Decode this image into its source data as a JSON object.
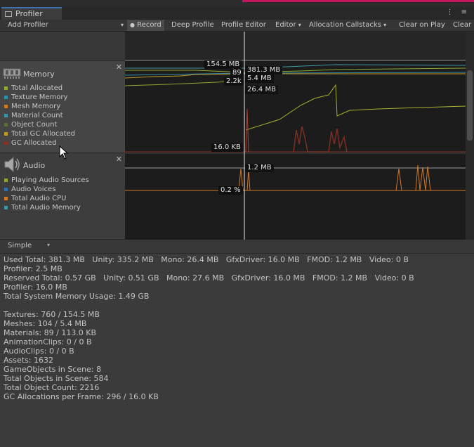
{
  "window": {
    "tab_title": "Profiler",
    "tab_icon": "profiler-icon",
    "window_buttons": "⋮ ≡"
  },
  "toolbar": {
    "add_profiler": "Add Profiler",
    "record": "Record",
    "deep_profile": "Deep Profile",
    "profile_editor": "Profile Editor",
    "editor": "Editor",
    "allocation_callstacks": "Allocation Callstacks",
    "clear_on_play": "Clear on Play",
    "clear": "Clear"
  },
  "memory": {
    "title": "Memory",
    "icon": "memory-chip-icon",
    "legend": [
      {
        "label": "Total Allocated",
        "color": "#8fa832"
      },
      {
        "label": "Texture Memory",
        "color": "#2f8fae"
      },
      {
        "label": "Mesh Memory",
        "color": "#d07a26"
      },
      {
        "label": "Material Count",
        "color": "#3f96a6"
      },
      {
        "label": "Object Count",
        "color": "#5a6e35"
      },
      {
        "label": "Total GC Allocated",
        "color": "#c29a2a"
      },
      {
        "label": "GC Allocated",
        "color": "#8a2f22"
      }
    ],
    "graph_labels": {
      "texture": "154.5 MB",
      "material": "89",
      "objects": "2.2k",
      "gc": "16.0 KB",
      "total": "381.3 MB",
      "mesh": "5.4 MB",
      "mono": "26.4 MB"
    }
  },
  "audio": {
    "title": "Audio",
    "icon": "speaker-icon",
    "legend": [
      {
        "label": "Playing Audio Sources",
        "color": "#8fa832"
      },
      {
        "label": "Audio Voices",
        "color": "#2f6fae"
      },
      {
        "label": "Total Audio CPU",
        "color": "#d07a26"
      },
      {
        "label": "Total Audio Memory",
        "color": "#3f96a6"
      }
    ],
    "graph_labels": {
      "memory": "1.2 MB",
      "cpu": "0.2 %"
    }
  },
  "detail_view": {
    "mode": "Simple",
    "lines": [
      "Used Total: 381.3 MB   Unity: 335.2 MB   Mono: 26.4 MB   GfxDriver: 16.0 MB   FMOD: 1.2 MB   Video: 0 B",
      "Profiler: 2.5 MB",
      "Reserved Total: 0.57 GB   Unity: 0.51 GB   Mono: 27.6 MB   GfxDriver: 16.0 MB   FMOD: 1.2 MB   Video: 0 B",
      "Profiler: 16.0 MB",
      "Total System Memory Usage: 1.49 GB",
      "",
      "Textures: 760 / 154.5 MB",
      "Meshes: 104 / 5.4 MB",
      "Materials: 89 / 113.0 KB",
      "AnimationClips: 0 / 0 B",
      "AudioClips: 0 / 0 B",
      "Assets: 1632",
      "GameObjects in Scene: 8",
      "Total Objects in Scene: 584",
      "Total Object Count: 2216",
      "GC Allocations per Frame: 296 / 16.0 KB"
    ]
  }
}
